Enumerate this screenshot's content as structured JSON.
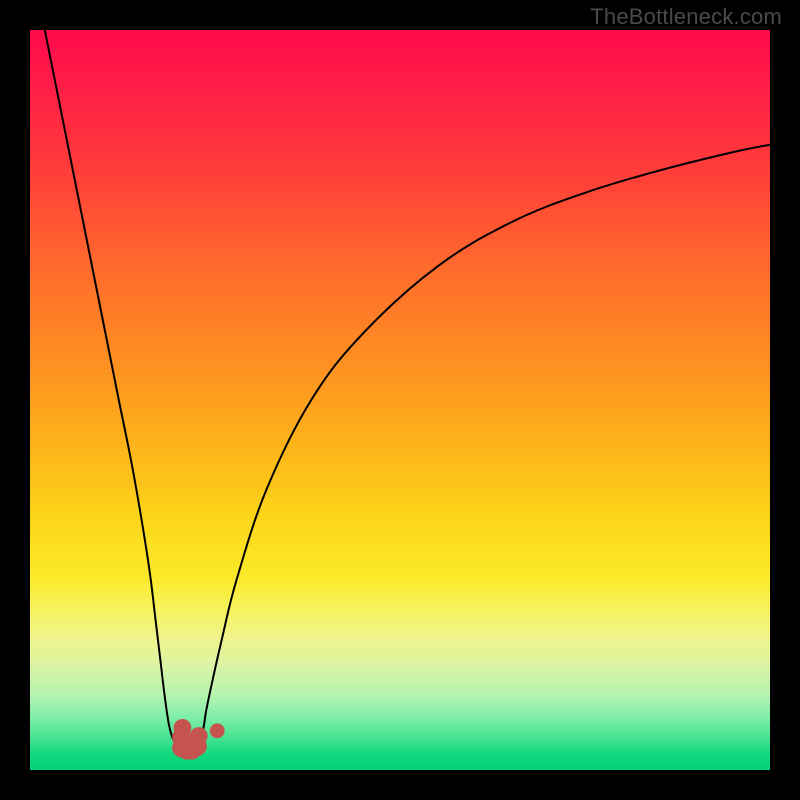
{
  "watermark": "TheBottleneck.com",
  "chart_data": {
    "type": "line",
    "title": "",
    "xlabel": "",
    "ylabel": "",
    "xlim": [
      0,
      100
    ],
    "ylim": [
      0,
      100
    ],
    "grid": false,
    "gradient_stops": [
      {
        "pct": 0,
        "color": "#ff0a4b"
      },
      {
        "pct": 8,
        "color": "#ff1e47"
      },
      {
        "pct": 20,
        "color": "#ff4038"
      },
      {
        "pct": 32,
        "color": "#ff6a2d"
      },
      {
        "pct": 44,
        "color": "#fe8d22"
      },
      {
        "pct": 56,
        "color": "#fdb31a"
      },
      {
        "pct": 66,
        "color": "#fcd518"
      },
      {
        "pct": 74,
        "color": "#fbea2a"
      },
      {
        "pct": 78,
        "color": "#f7f25a"
      },
      {
        "pct": 82,
        "color": "#f0f48a"
      },
      {
        "pct": 86,
        "color": "#daf4a5"
      },
      {
        "pct": 90,
        "color": "#b3f3b0"
      },
      {
        "pct": 93,
        "color": "#7ceda7"
      },
      {
        "pct": 96,
        "color": "#3ee18f"
      },
      {
        "pct": 98,
        "color": "#10d87e"
      },
      {
        "pct": 100,
        "color": "#07d178"
      }
    ],
    "series": [
      {
        "name": "left-branch",
        "x": [
          2.0,
          4.0,
          6.0,
          8.0,
          10.0,
          12.0,
          14.0,
          16.0,
          17.0,
          17.6,
          18.2,
          18.8,
          19.4,
          20.0,
          20.5
        ],
        "values": [
          100,
          90.0,
          80.0,
          70.0,
          60.0,
          50.0,
          40.0,
          28.0,
          20.0,
          15.0,
          10.0,
          6.0,
          4.0,
          3.2,
          3.0
        ]
      },
      {
        "name": "right-branch",
        "x": [
          22.5,
          23.0,
          23.5,
          24.0,
          26.0,
          28.0,
          32.0,
          38.0,
          45.0,
          55.0,
          65.0,
          75.0,
          85.0,
          95.0,
          100.0
        ],
        "values": [
          3.0,
          4.0,
          6.0,
          9.0,
          18.0,
          26.0,
          38.0,
          50.0,
          59.0,
          68.0,
          74.0,
          78.0,
          81.0,
          83.5,
          84.5
        ]
      }
    ],
    "markers": [
      {
        "name": "valley-left-dot-1",
        "x": 20.5,
        "y": 3.0,
        "r": 1.3,
        "color": "#c5544f"
      },
      {
        "name": "valley-left-dot-2",
        "x": 20.5,
        "y": 4.4,
        "r": 1.3,
        "color": "#c5544f"
      },
      {
        "name": "valley-left-dot-3",
        "x": 20.6,
        "y": 5.7,
        "r": 1.2,
        "color": "#c5544f"
      },
      {
        "name": "valley-bottom-dot-1",
        "x": 21.2,
        "y": 2.6,
        "r": 1.2,
        "color": "#c5544f"
      },
      {
        "name": "valley-bottom-dot-2",
        "x": 21.9,
        "y": 2.6,
        "r": 1.2,
        "color": "#c5544f"
      },
      {
        "name": "valley-right-dot-1",
        "x": 22.6,
        "y": 3.2,
        "r": 1.3,
        "color": "#c5544f"
      },
      {
        "name": "valley-right-dot-2",
        "x": 22.8,
        "y": 4.6,
        "r": 1.2,
        "color": "#c5544f"
      },
      {
        "name": "outlier-dot",
        "x": 25.3,
        "y": 5.3,
        "r": 1.0,
        "color": "#c5544f"
      }
    ]
  }
}
